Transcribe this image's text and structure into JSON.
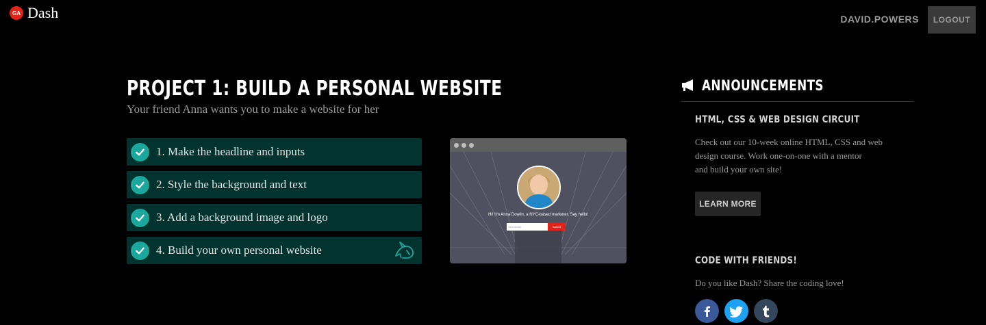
{
  "header": {
    "logo_badge": "GA",
    "logo_text": "Dash",
    "username": "DAVID.POWERS",
    "logout_label": "LOGOUT"
  },
  "project": {
    "title": "PROJECT 1: BUILD A PERSONAL WEBSITE",
    "subtitle": "Your friend Anna wants you to make a website for her",
    "steps": [
      {
        "label": "1. Make the headline and inputs",
        "completed": true
      },
      {
        "label": "2. Style the background and text",
        "completed": true
      },
      {
        "label": "3. Add a background image and logo",
        "completed": true
      },
      {
        "label": "4. Build your own personal website",
        "completed": true
      }
    ]
  },
  "preview": {
    "greeting": "Hi! I'm Anna Dowlin, a NYC-based marketer. Say hello!",
    "email_placeholder": "Your email",
    "submit_label": "Submit"
  },
  "announcements": {
    "title": "ANNOUNCEMENTS",
    "course_title": "HTML, CSS & WEB DESIGN CIRCUIT",
    "course_line1": "Check out our 10-week online HTML, CSS and web",
    "course_line2": "design course. Work one-on-one with a mentor",
    "course_line3": "and build your own site!",
    "learn_more_label": "LEARN MORE",
    "friends_title": "CODE WITH FRIENDS!",
    "friends_text": "Do you like Dash? Share the coding love!"
  },
  "colors": {
    "step_bg": "#02332f",
    "check_bg": "#1ba79b",
    "facebook": "#3b5998",
    "twitter": "#1da1f2",
    "tumblr": "#35465c"
  },
  "social_icons": [
    "facebook-icon",
    "twitter-icon",
    "tumblr-icon"
  ]
}
